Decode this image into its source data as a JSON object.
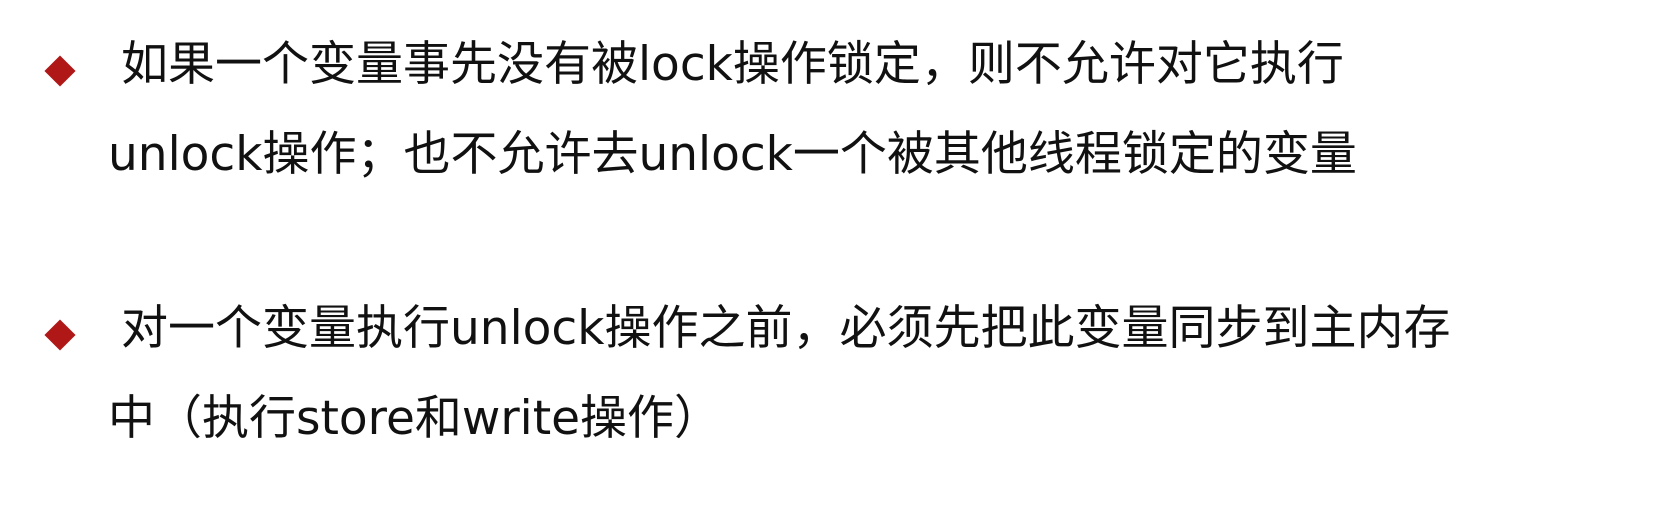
{
  "bullets": [
    {
      "lines": [
        "如果一个变量事先没有被lock操作锁定，则不允许对它执行",
        "unlock操作；也不允许去unlock一个被其他线程锁定的变量"
      ]
    },
    {
      "lines": [
        "对一个变量执行unlock操作之前，必须先把此变量同步到主内存",
        "中（执行store和write操作）"
      ]
    }
  ],
  "colors": {
    "bullet_marker": "#b01818",
    "text": "#111111",
    "background": "#ffffff"
  },
  "icons": {
    "bullet": "diamond-bullet-icon"
  }
}
